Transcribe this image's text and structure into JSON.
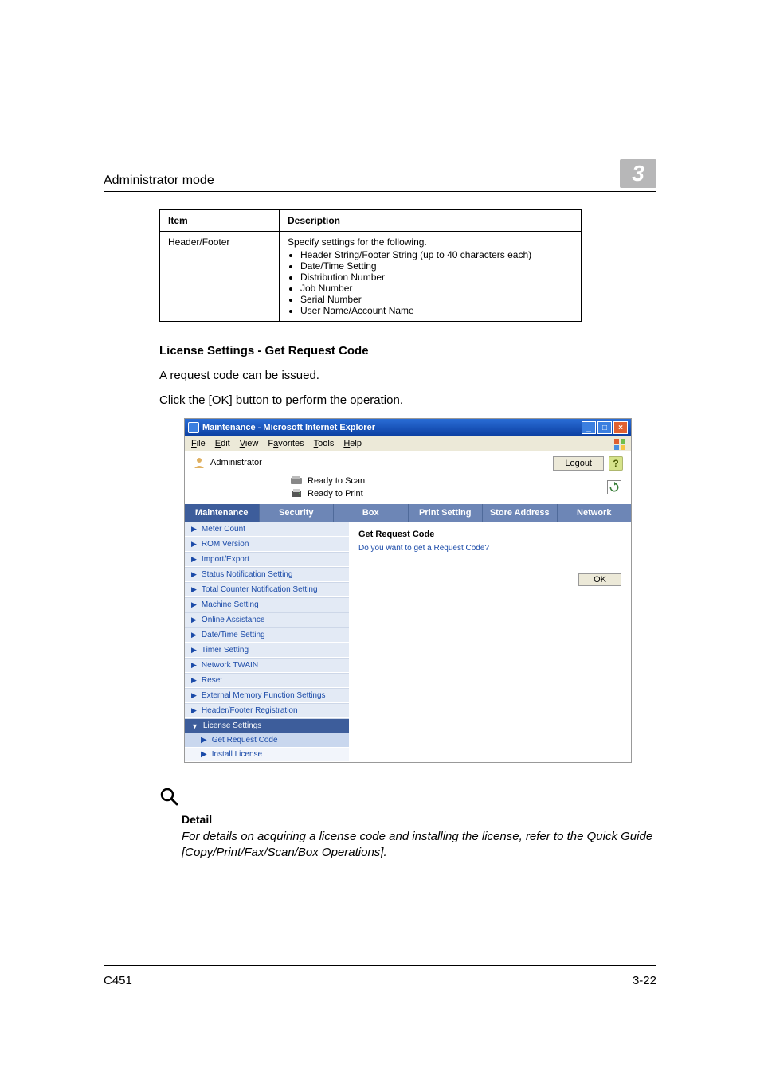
{
  "page_header": {
    "title": "Administrator mode",
    "chapter_number": "3"
  },
  "table": {
    "headers": {
      "item": "Item",
      "description": "Description"
    },
    "row": {
      "item": "Header/Footer",
      "desc_intro": "Specify settings for the following.",
      "bullets": [
        "Header String/Footer String (up to 40 characters each)",
        "Date/Time Setting",
        "Distribution Number",
        "Job Number",
        "Serial Number",
        "User Name/Account Name"
      ]
    }
  },
  "section": {
    "heading": "License Settings - Get Request Code",
    "p1": "A request code can be issued.",
    "p2": "Click the [OK] button to perform the operation."
  },
  "screenshot": {
    "titlebar": "Maintenance - Microsoft Internet Explorer",
    "win_min": "_",
    "win_max": "□",
    "win_close": "×",
    "menu": {
      "file": "File",
      "edit": "Edit",
      "view": "View",
      "favorites": "Favorites",
      "tools": "Tools",
      "help": "Help"
    },
    "admin_label": "Administrator",
    "logout": "Logout",
    "help": "?",
    "status1": "Ready to Scan",
    "status2": "Ready to Print",
    "tabs": [
      "Maintenance",
      "Security",
      "Box",
      "Print Setting",
      "Store Address",
      "Network"
    ],
    "active_tab_index": 0,
    "sidebar": [
      "Meter Count",
      "ROM Version",
      "Import/Export",
      "Status Notification Setting",
      "Total Counter Notification Setting",
      "Machine Setting",
      "Online Assistance",
      "Date/Time Setting",
      "Timer Setting",
      "Network TWAIN",
      "Reset",
      "External Memory Function Settings",
      "Header/Footer Registration"
    ],
    "sidebar_expanded": {
      "header": "License Settings",
      "children": [
        "Get Request Code",
        "Install License"
      ],
      "selected_index": 0
    },
    "content": {
      "title": "Get Request Code",
      "text": "Do you want to get a Request Code?",
      "ok": "OK"
    }
  },
  "note": {
    "heading": "Detail",
    "text": "For details on acquiring a license code and installing the license, refer to the Quick Guide [Copy/Print/Fax/Scan/Box Operations]."
  },
  "footer": {
    "model": "C451",
    "page": "3-22"
  }
}
